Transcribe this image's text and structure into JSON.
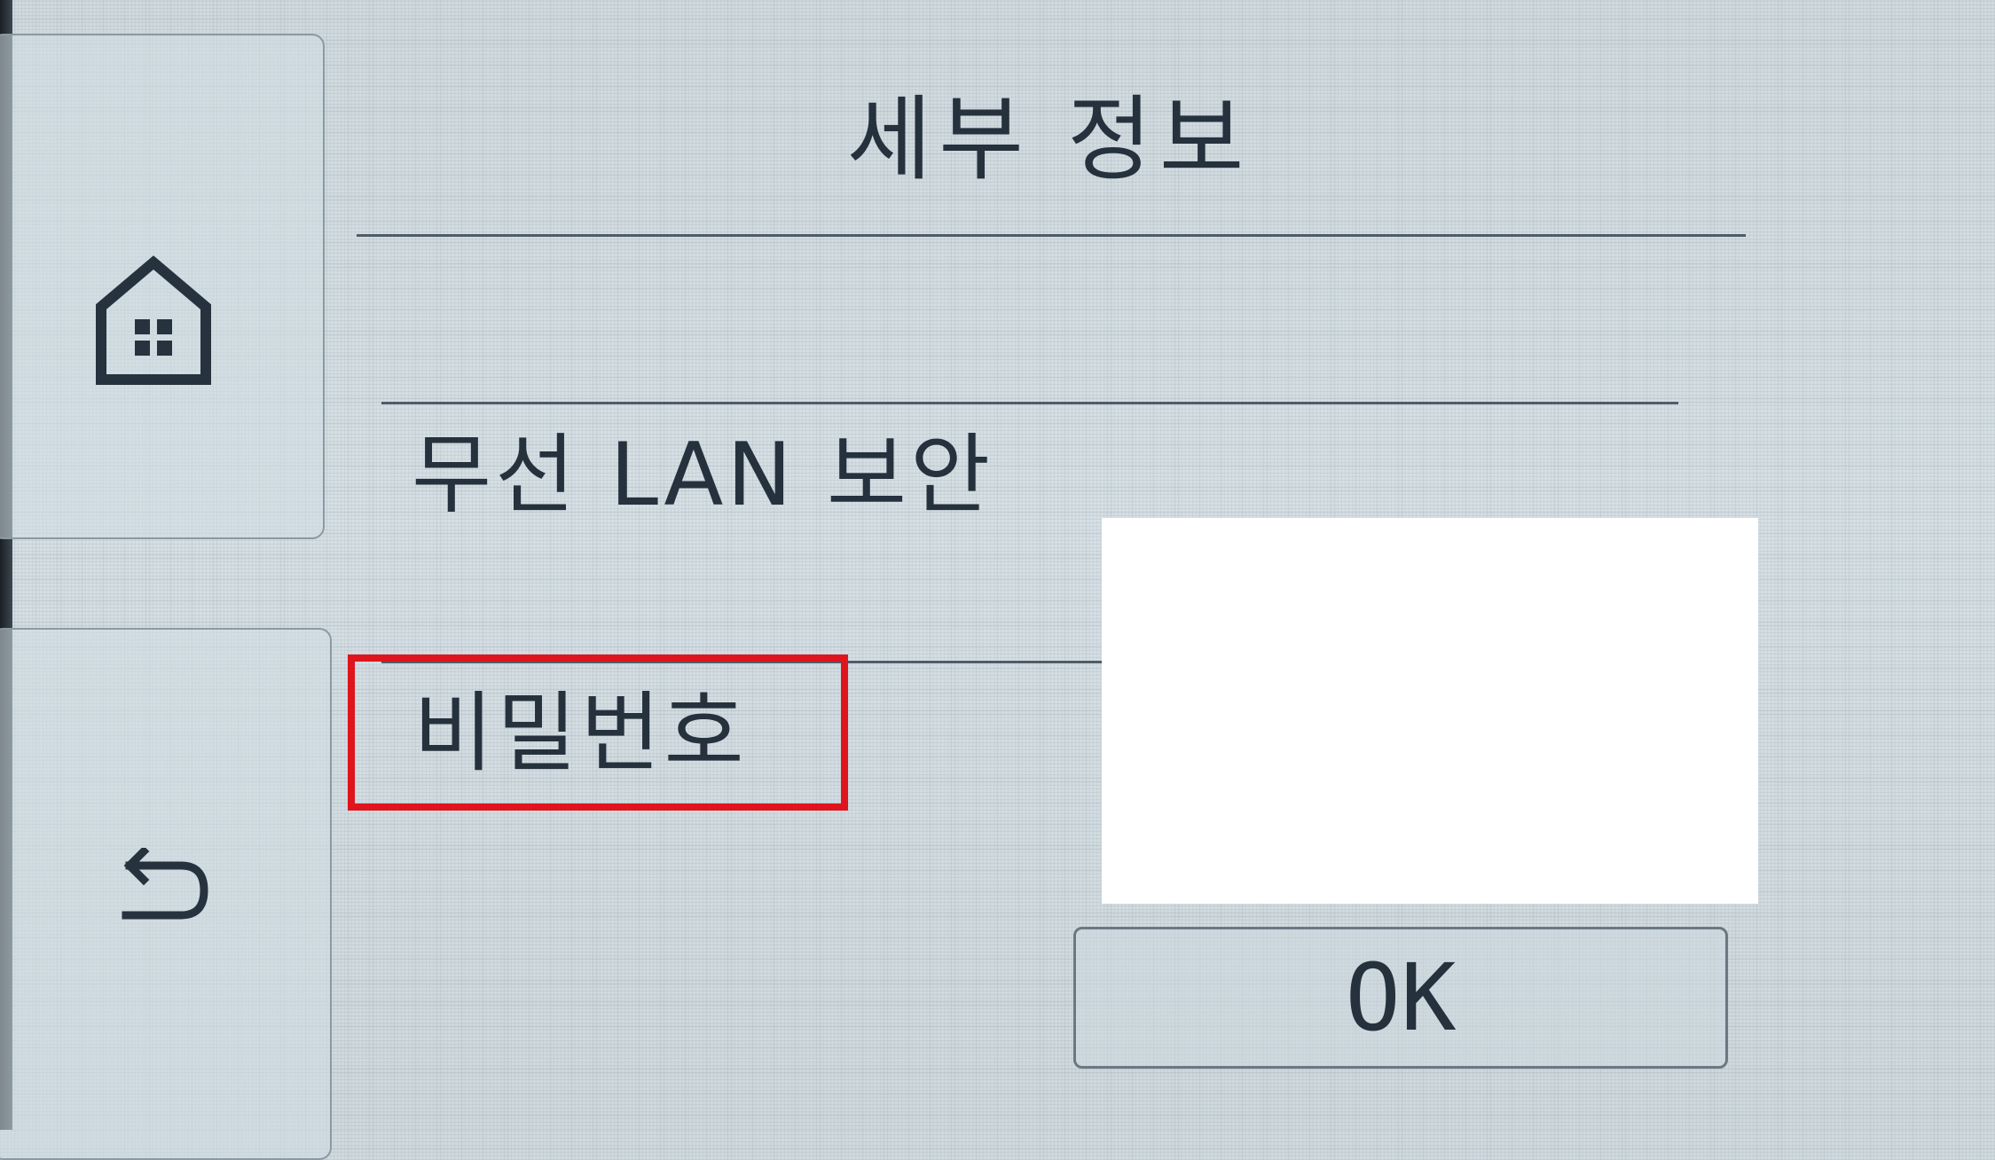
{
  "screen": {
    "title": "세부 정보"
  },
  "sidebar": {
    "home_icon": "home-icon",
    "back_icon": "back-arrow-icon"
  },
  "rows": [
    {
      "label": "무선 LAN 보안"
    },
    {
      "label": "비밀번호"
    }
  ],
  "actions": {
    "ok_label": "OK"
  },
  "colors": {
    "background": "#d3dde2",
    "text": "#25313c",
    "highlight": "#e0141c",
    "redaction": "#ffffff"
  }
}
